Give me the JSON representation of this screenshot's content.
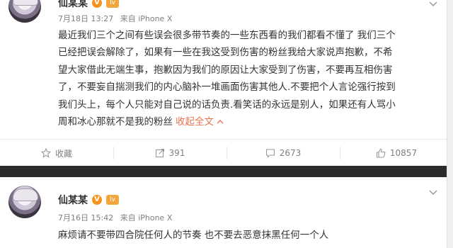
{
  "posts": [
    {
      "author": "仙某某",
      "vip_mark": "V",
      "level_mark": "lv",
      "date": "7月18日 13:27",
      "source": "来自 iPhone X",
      "lines": [
        "最近我们三个之间有些误会很多带节奏的一些东西看的我们都看不懂了 我们三个",
        "已经把误会解除了，如果有一些在我这受到伤害的粉丝我给大家说声抱歉，不希",
        "望大家借此无端生事，抱歉因为我们的原因让大家受到了伤害，不要再互相伤害",
        "了，不要妄自揣测我们的内心脑补一堆画面伤害其他人.不要把个人言论强行按到",
        "我们头上，每个人只能对自己说的话负责.看笑话的永远是别人，如果还有人骂小",
        "周和冰心那就不是我的粉丝"
      ],
      "expand_label": "收起全文",
      "actions": {
        "favorite": "收藏",
        "repost": "391",
        "comment": "2673",
        "like": "10857"
      }
    },
    {
      "author": "仙某某",
      "vip_mark": "V",
      "level_mark": "lv",
      "date": "7月16日 15:42",
      "source": "来自 iPhone X",
      "lines": [
        "麻烦请不要带四合院任何人的节奏 也不要去恶意抹黑任何一个人"
      ]
    }
  ],
  "icons": {
    "favorite": "star-icon",
    "repost": "repost-icon",
    "comment": "comment-icon",
    "like": "thumbs-up-icon",
    "menu": "chevron-down-icon"
  },
  "colors": {
    "accent": "#eb7350",
    "badge_orange": "#f7931e",
    "text": "#333333",
    "meta": "#808080"
  }
}
